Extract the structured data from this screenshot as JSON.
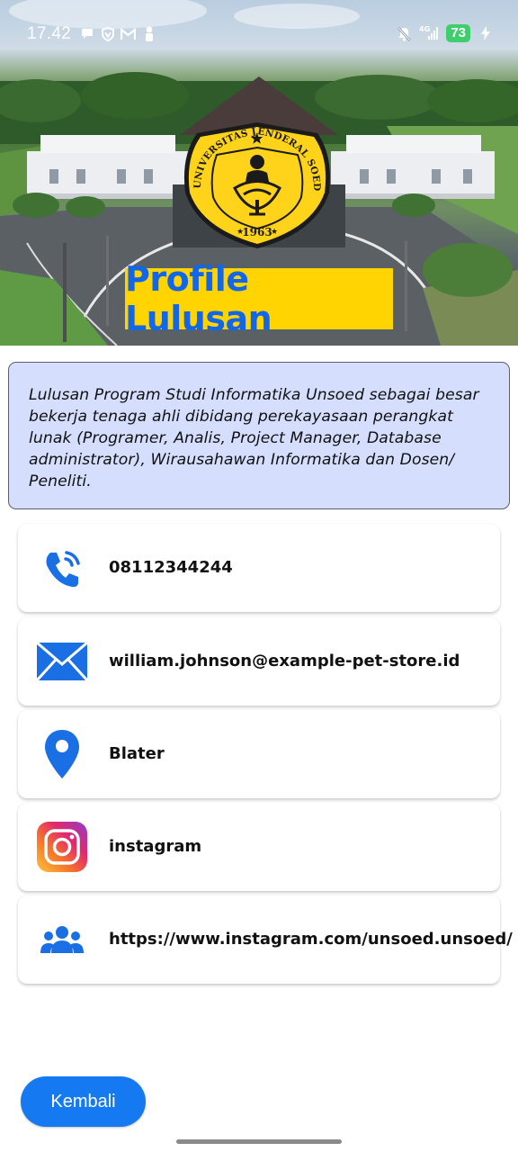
{
  "status_bar": {
    "time": "17.42",
    "left_icons": [
      "chat-bubble-icon",
      "vpn-shield-icon",
      "gmail-icon",
      "person-icon"
    ],
    "right_icons": [
      "bell-muted-icon",
      "signal-4g-icon",
      "battery-icon",
      "charging-bolt-icon"
    ],
    "network": "4G",
    "battery": "73",
    "battery_color": "#3ecf6c"
  },
  "header": {
    "title": "Profile Lulusan",
    "title_color": "#1367e6",
    "title_background": "#ffd400",
    "seal": {
      "top_text": "UNIVERSITAS JENDERAL SOEDIRMAN",
      "year": "1963"
    }
  },
  "description": {
    "text": "Lulusan Program Studi Informatika Unsoed sebagai besar bekerja tenaga ahli dibidang perekayasaan perangkat lunak (Programer, Analis, Project Manager, Database administrator), Wirausahawan Informatika dan Dosen/ Peneliti.",
    "background": "#d5dffd"
  },
  "contacts": [
    {
      "icon": "phone-icon",
      "value": "08112344244"
    },
    {
      "icon": "email-icon",
      "value": "william.johnson@example-pet-store.id"
    },
    {
      "icon": "location-pin-icon",
      "value": "Blater"
    },
    {
      "icon": "instagram-icon",
      "value": "instagram"
    },
    {
      "icon": "group-icon",
      "value": "https://www.instagram.com/unsoed.unsoed/"
    }
  ],
  "footer": {
    "back_button": "Kembali",
    "accent": "#1579f2"
  }
}
